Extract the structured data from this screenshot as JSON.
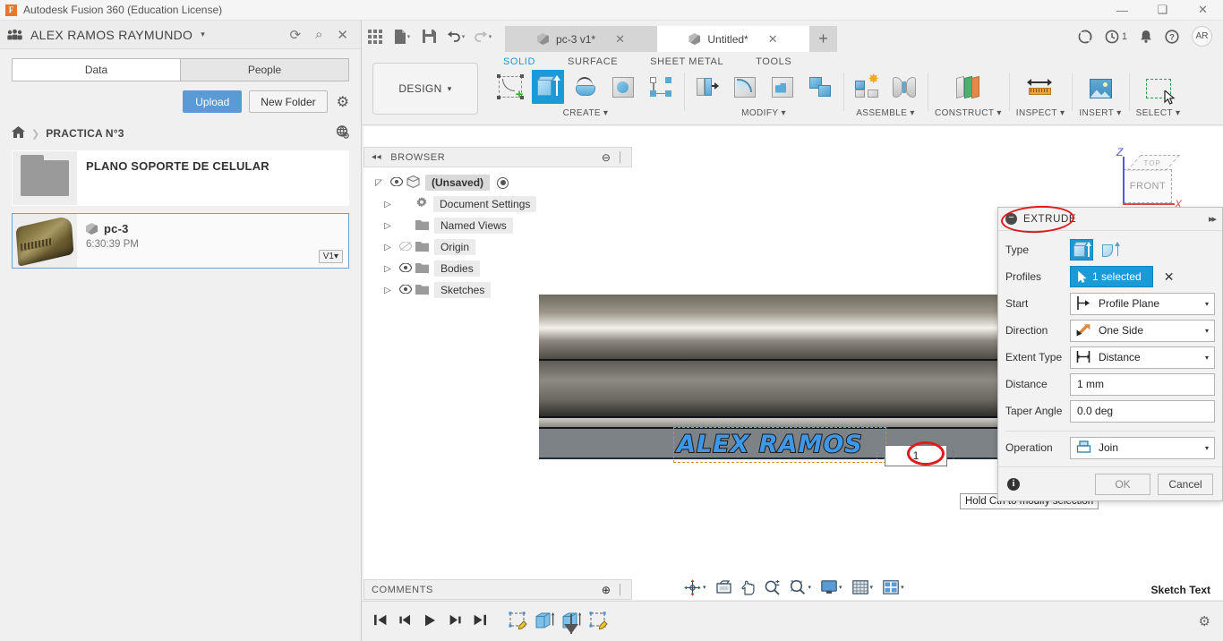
{
  "window": {
    "title": "Autodesk Fusion 360 (Education License)",
    "logo_letter": "F",
    "minimize": "—",
    "maximize": "❑",
    "close": "✕"
  },
  "data_panel": {
    "user_name": "ALEX RAMOS RAYMUNDO",
    "caret": "▾",
    "header_icons": [
      {
        "name": "refresh-icon",
        "glyph": "⟳"
      },
      {
        "name": "search-icon",
        "glyph": "⌕"
      },
      {
        "name": "close-panel-icon",
        "glyph": "✕"
      }
    ],
    "tabs": [
      {
        "label": "Data",
        "active": true
      },
      {
        "label": "People",
        "active": false
      }
    ],
    "upload_label": "Upload",
    "new_folder_label": "New Folder",
    "settings_icon": "⚙",
    "breadcrumb": {
      "home_icon": "⌂",
      "separator": "❯",
      "project": "PRACTICA N°3",
      "globe_icon": "⊕"
    },
    "items": [
      {
        "kind": "folder",
        "title": "PLANO SOPORTE DE CELULAR",
        "subtitle": "",
        "version": "",
        "selected": false
      },
      {
        "kind": "document",
        "title": "pc-3",
        "subtitle": "6:30:39 PM",
        "version": "V1",
        "version_caret": "▾",
        "selected": true
      }
    ]
  },
  "quick_access": {
    "icons": [
      {
        "name": "app-grid-icon",
        "glyph": "grid"
      },
      {
        "name": "new-file-icon",
        "glyph": "▤"
      },
      {
        "name": "save-icon",
        "glyph": "💾"
      },
      {
        "name": "undo-icon",
        "glyph": "↶"
      },
      {
        "name": "redo-icon",
        "glyph": "↷"
      }
    ],
    "doc_tabs": [
      {
        "label": "pc-3 v1*",
        "active": false,
        "close": "✕"
      },
      {
        "label": "Untitled*",
        "active": true,
        "close": "✕"
      }
    ],
    "add_tab": "+",
    "right_icons": [
      {
        "name": "extensions-icon",
        "glyph": "⚈",
        "badge": ""
      },
      {
        "name": "job-status-icon",
        "glyph": "◴",
        "badge": "1"
      },
      {
        "name": "notifications-icon",
        "glyph": "🔔",
        "badge": ""
      },
      {
        "name": "help-icon",
        "glyph": "?",
        "badge": ""
      }
    ],
    "avatar_initials": "AR"
  },
  "ribbon": {
    "workspace": "DESIGN",
    "workspace_caret": "▾",
    "tabs": [
      {
        "label": "SOLID",
        "active": true
      },
      {
        "label": "SURFACE",
        "active": false
      },
      {
        "label": "SHEET METAL",
        "active": false
      },
      {
        "label": "TOOLS",
        "active": false
      }
    ],
    "panels": [
      {
        "label": "CREATE",
        "caret": "▾"
      },
      {
        "label": "MODIFY",
        "caret": "▾"
      },
      {
        "label": "ASSEMBLE",
        "caret": "▾"
      },
      {
        "label": "CONSTRUCT",
        "caret": "▾"
      },
      {
        "label": "INSPECT",
        "caret": "▾"
      },
      {
        "label": "INSERT",
        "caret": "▾"
      },
      {
        "label": "SELECT",
        "caret": "▾"
      }
    ]
  },
  "browser": {
    "title": "BROWSER",
    "collapse_icon": "◂◂",
    "minus_icon": "⊖",
    "grip": "│",
    "nodes": [
      {
        "label": "(Unsaved)",
        "indent": 0,
        "arrow": "◸",
        "eye": "◉",
        "eye_off": false,
        "icon": "component",
        "radio": true
      },
      {
        "label": "Document Settings",
        "indent": 1,
        "arrow": "▷",
        "eye": "",
        "eye_off": false,
        "icon": "gear",
        "radio": false
      },
      {
        "label": "Named Views",
        "indent": 1,
        "arrow": "▷",
        "eye": "",
        "eye_off": false,
        "icon": "folder",
        "radio": false
      },
      {
        "label": "Origin",
        "indent": 1,
        "arrow": "▷",
        "eye": "⌾",
        "eye_off": true,
        "icon": "folder",
        "radio": false
      },
      {
        "label": "Bodies",
        "indent": 1,
        "arrow": "▷",
        "eye": "◉",
        "eye_off": false,
        "icon": "folder",
        "radio": false
      },
      {
        "label": "Sketches",
        "indent": 1,
        "arrow": "▷",
        "eye": "◉",
        "eye_off": false,
        "icon": "folder",
        "radio": false
      }
    ]
  },
  "canvas": {
    "sketch_text": "ALEX RAMOS",
    "value_field": "1",
    "tooltip": "Hold Ctrl to modify selection",
    "viewcube": {
      "top": "TOP",
      "front": "FRONT",
      "z_axis": "Z",
      "x_axis": "X"
    },
    "annotation_color": "#e01b1b"
  },
  "extrude_dialog": {
    "title": "EXTRUDE",
    "minus": "−",
    "expand": "▸▸",
    "type_label": "Type",
    "type_options": [
      {
        "name": "extrude-straight",
        "selected": true
      },
      {
        "name": "extrude-tapered",
        "selected": false
      }
    ],
    "profiles_label": "Profiles",
    "profiles_value": "1 selected",
    "profiles_clear": "✕",
    "start_label": "Start",
    "start_value": "Profile Plane",
    "direction_label": "Direction",
    "direction_value": "One Side",
    "extent_type_label": "Extent Type",
    "extent_type_value": "Distance",
    "distance_label": "Distance",
    "distance_value": "1 mm",
    "taper_angle_label": "Taper Angle",
    "taper_angle_value": "0.0 deg",
    "operation_label": "Operation",
    "operation_value": "Join",
    "caret": "▾",
    "info_icon": "i",
    "ok_label": "OK",
    "cancel_label": "Cancel",
    "accent_color": "#1a9ad7"
  },
  "comments": {
    "title": "COMMENTS",
    "plus_icon": "⊕",
    "grip": "│"
  },
  "navbar": {
    "items": [
      {
        "name": "orbit-icon",
        "caret": "▾"
      },
      {
        "name": "look-at-icon",
        "caret": ""
      },
      {
        "name": "pan-icon",
        "caret": ""
      },
      {
        "name": "zoom-icon",
        "caret": ""
      },
      {
        "name": "zoom-window-icon",
        "caret": "▾"
      },
      {
        "name": "display-settings-icon",
        "caret": "▾"
      },
      {
        "name": "grid-snaps-icon",
        "caret": "▾"
      },
      {
        "name": "viewports-icon",
        "caret": "▾"
      }
    ]
  },
  "status": {
    "bottom_right_label": "Sketch Text"
  },
  "timeline": {
    "playback": [
      {
        "name": "go-to-beginning-icon",
        "glyph": "⏮"
      },
      {
        "name": "step-back-icon",
        "glyph": "⏴"
      },
      {
        "name": "play-icon",
        "glyph": "▶"
      },
      {
        "name": "step-forward-icon",
        "glyph": "⏵"
      },
      {
        "name": "go-to-end-icon",
        "glyph": "⏭"
      }
    ],
    "features": [
      {
        "name": "sketch-feature"
      },
      {
        "name": "extrude-feature-1"
      },
      {
        "name": "extrude-feature-2"
      },
      {
        "name": "sketch-feature-2"
      }
    ],
    "settings_icon": "⚙"
  }
}
